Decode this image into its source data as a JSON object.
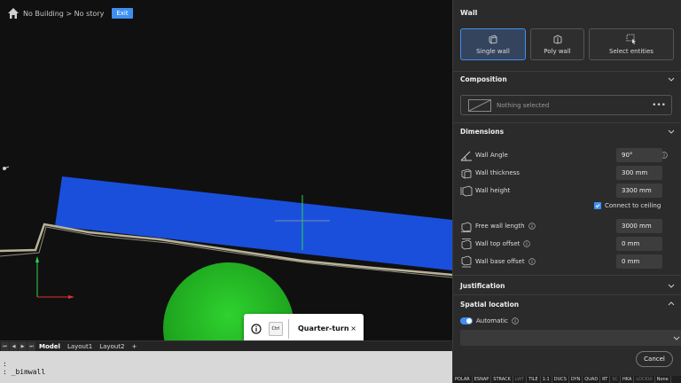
{
  "breadcrumb": {
    "text": "No Building > No story",
    "exit_label": "Exit"
  },
  "layout_tabs": {
    "model": "Model",
    "layout1": "Layout1",
    "layout2": "Layout2",
    "add": "+"
  },
  "command_line": {
    "line1": ":",
    "line2": ": _bimwall"
  },
  "tooltip": {
    "key": "Ctrl",
    "text": "Quarter-turn",
    "close": "×"
  },
  "panel": {
    "title": "Wall",
    "modes": [
      {
        "label": "Single wall",
        "active": true
      },
      {
        "label": "Poly wall",
        "active": false
      },
      {
        "label": "Select entities",
        "active": false
      }
    ],
    "composition": {
      "header": "Composition",
      "placeholder": "Nothing selected",
      "more": "•••"
    },
    "dimensions": {
      "header": "Dimensions",
      "wall_angle": {
        "label": "Wall Angle",
        "value": "90°"
      },
      "wall_thickness": {
        "label": "Wall thickness",
        "value": "300 mm"
      },
      "wall_height": {
        "label": "Wall height",
        "value": "3300 mm"
      },
      "connect_to_ceiling": {
        "label": "Connect to ceiling",
        "checked": true
      },
      "free_wall_length": {
        "label": "Free wall length",
        "value": "3000 mm"
      },
      "wall_top_offset": {
        "label": "Wall top offset",
        "value": "0 mm"
      },
      "wall_base_offset": {
        "label": "Wall base offset",
        "value": "0 mm"
      }
    },
    "justification": {
      "header": "Justification"
    },
    "spatial_location": {
      "header": "Spatial location",
      "automatic_label": "Automatic",
      "automatic_on": true
    },
    "cancel_label": "Cancel"
  },
  "status_bar": [
    {
      "label": "POLAR",
      "on": true
    },
    {
      "label": "ESNAP",
      "on": true
    },
    {
      "label": "STRACK",
      "on": true
    },
    {
      "label": "LWT",
      "on": false
    },
    {
      "label": "TILE",
      "on": true
    },
    {
      "label": "1:1",
      "on": true
    },
    {
      "label": "DUCS",
      "on": true
    },
    {
      "label": "DYN",
      "on": true
    },
    {
      "label": "QUAD",
      "on": true
    },
    {
      "label": "RT",
      "on": true
    },
    {
      "label": "SC",
      "on": false
    },
    {
      "label": "HKA",
      "on": true
    },
    {
      "label": "LOCKUI",
      "on": false
    },
    {
      "label": "None",
      "on": true
    }
  ],
  "colors": {
    "accent": "#3f8ff0",
    "wall": "#1a4fdc",
    "ground": "#2fc02f"
  }
}
